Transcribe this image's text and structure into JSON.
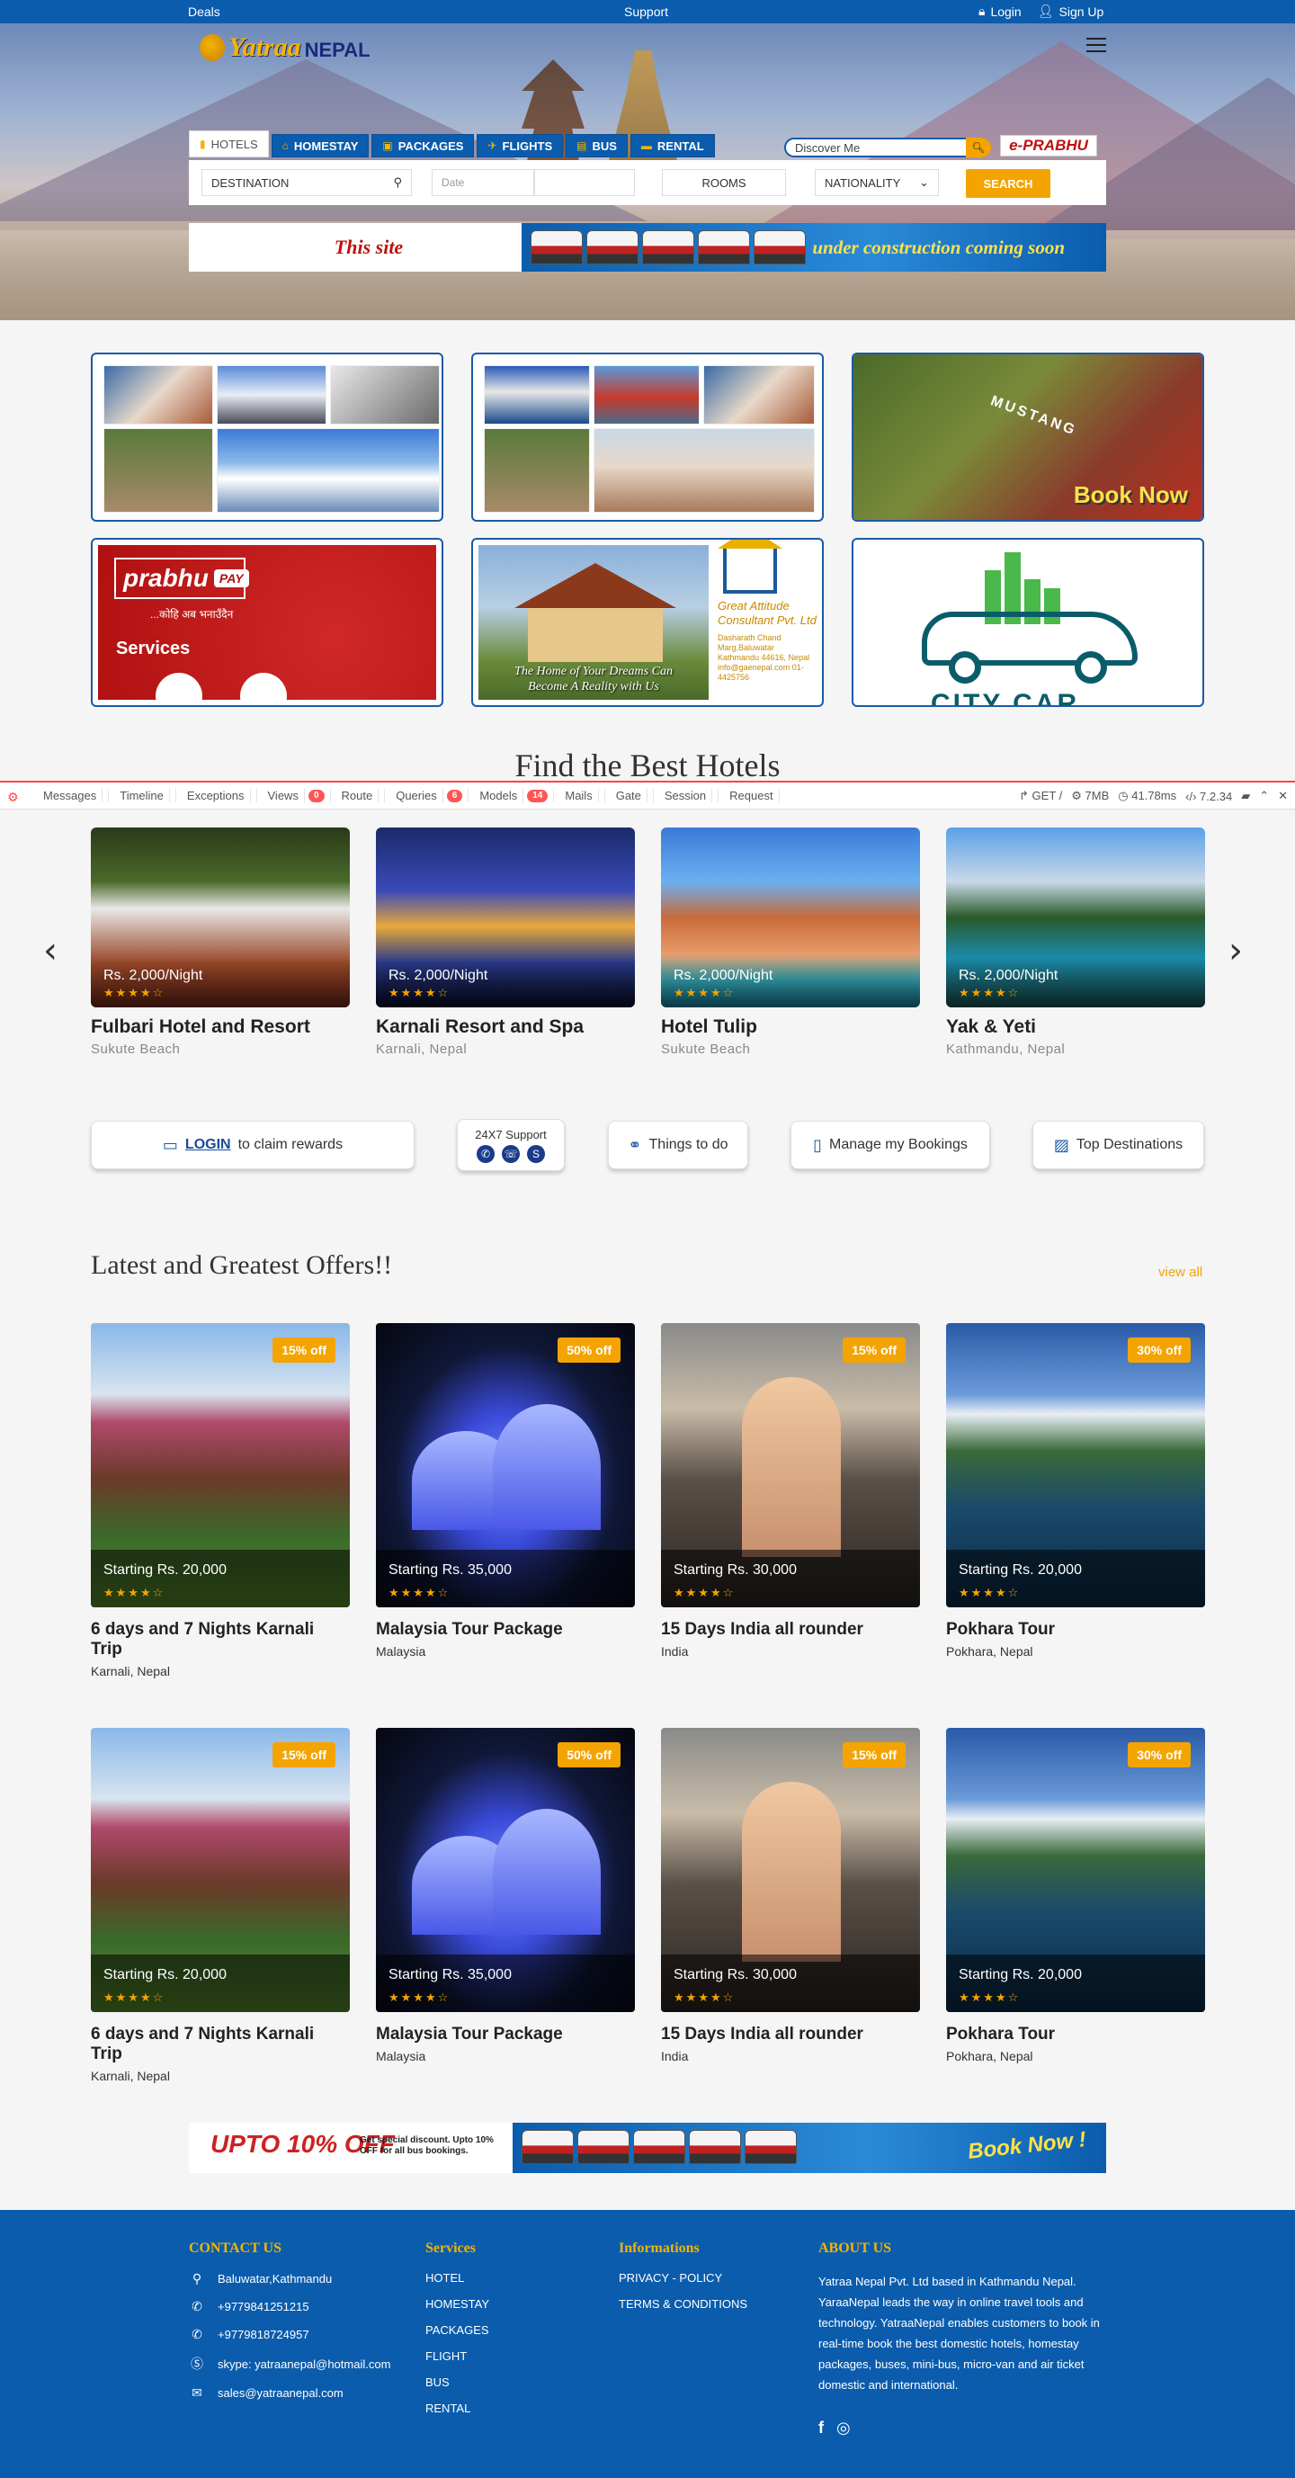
{
  "topbar": {
    "deals": "Deals",
    "support": "Support",
    "login": "Login",
    "signup": "Sign Up"
  },
  "logo": {
    "word": "Yatraa",
    "sub": "NEPAL"
  },
  "search": {
    "tabs": [
      {
        "label": "HOTELS",
        "icon": "building-icon"
      },
      {
        "label": "HOMESTAY",
        "icon": "home-icon"
      },
      {
        "label": "PACKAGES",
        "icon": "suitcase-icon"
      },
      {
        "label": "FLIGHTS",
        "icon": "plane-icon"
      },
      {
        "label": "BUS",
        "icon": "bus-icon"
      },
      {
        "label": "RENTAL",
        "icon": "car-icon"
      }
    ],
    "discover_placeholder": "Discover Me",
    "eprabhu": "e-PRABHU",
    "destination": "DESTINATION",
    "date_placeholder": "Date",
    "rooms": "ROOMS",
    "nationality": "NATIONALITY",
    "button": "SEARCH"
  },
  "construction_banner": {
    "left": "This site",
    "right": "under construction coming soon"
  },
  "promos": {
    "mustang_book": "Book Now",
    "mustang_sign": "MUSTANG",
    "prabhu_logo": "prabhu",
    "prabhu_pay": "PAY",
    "prabhu_tagline": "...कोहि अब भनाउँदैन",
    "prabhu_services": "Services",
    "house_tagline_1": "The Home of Your Dreams Can",
    "house_tagline_2": "Become A Reality with Us",
    "gac_name": "Great Attitude Consultant Pvt. Ltd",
    "gac_address": "Dasharath Chand Marg,Baluwatar Kathmandu 44616, Nepal info@gaenepal.com 01-4425756",
    "citycar": "CITY CAR"
  },
  "hotels_section": {
    "title": "Find the Best Hotels"
  },
  "debugbar": {
    "items": [
      {
        "label": "Messages"
      },
      {
        "label": "Timeline"
      },
      {
        "label": "Exceptions"
      },
      {
        "label": "Views",
        "badge": "0"
      },
      {
        "label": "Route"
      },
      {
        "label": "Queries",
        "badge": "6"
      },
      {
        "label": "Models",
        "badge": "14"
      },
      {
        "label": "Mails"
      },
      {
        "label": "Gate"
      },
      {
        "label": "Session"
      },
      {
        "label": "Request"
      }
    ],
    "method": "GET /",
    "memory": "7MB",
    "time": "41.78ms",
    "version": "7.2.34"
  },
  "hotels": [
    {
      "name": "Fulbari Hotel and Resort",
      "location": "Sukute Beach",
      "price": "Rs. 2,000/Night",
      "rating": 4
    },
    {
      "name": "Karnali Resort and Spa",
      "location": "Karnali, Nepal",
      "price": "Rs. 2,000/Night",
      "rating": 4
    },
    {
      "name": "Hotel Tulip",
      "location": "Sukute Beach",
      "price": "Rs. 2,000/Night",
      "rating": 4
    },
    {
      "name": "Yak & Yeti",
      "location": "Kathmandu, Nepal",
      "price": "Rs. 2,000/Night",
      "rating": 4
    }
  ],
  "quicklinks": {
    "login": "LOGIN",
    "claim": "to claim rewards",
    "support": "24X7 Support",
    "things": "Things to do",
    "bookings": "Manage my Bookings",
    "destinations": "Top Destinations"
  },
  "offers_section": {
    "title": "Latest and Greatest Offers!!",
    "view_all": "view all"
  },
  "offers": [
    {
      "name": "6 days and 7 Nights Karnali Trip",
      "location": "Karnali, Nepal",
      "price": "Starting Rs. 20,000",
      "discount": "15% off",
      "rating": 4
    },
    {
      "name": "Malaysia Tour Package",
      "location": "Malaysia",
      "price": "Starting Rs. 35,000",
      "discount": "50% off",
      "rating": 4
    },
    {
      "name": "15 Days India all rounder",
      "location": "India",
      "price": "Starting Rs. 30,000",
      "discount": "15% off",
      "rating": 4
    },
    {
      "name": "Pokhara Tour",
      "location": "Pokhara, Nepal",
      "price": "Starting Rs. 20,000",
      "discount": "30% off",
      "rating": 4
    },
    {
      "name": "6 days and 7 Nights Karnali Trip",
      "location": "Karnali, Nepal",
      "price": "Starting Rs. 20,000",
      "discount": "15% off",
      "rating": 4
    },
    {
      "name": "Malaysia Tour Package",
      "location": "Malaysia",
      "price": "Starting Rs. 35,000",
      "discount": "50% off",
      "rating": 4
    },
    {
      "name": "15 Days India all rounder",
      "location": "India",
      "price": "Starting Rs. 30,000",
      "discount": "15% off",
      "rating": 4
    },
    {
      "name": "Pokhara Tour",
      "location": "Pokhara, Nepal",
      "price": "Starting Rs. 20,000",
      "discount": "30% off",
      "rating": 4
    }
  ],
  "bus_banner": {
    "upto": "UPTO 10% OFF",
    "discount": "Get special discount. Upto 10% OFF for all bus bookings.",
    "book": "Book Now !"
  },
  "footer": {
    "contact_title": "CONTACT US",
    "contact": {
      "address": "Baluwatar,Kathmandu",
      "phone1": "+9779841251215",
      "phone2": "+9779818724957",
      "skype": "skype: yatraanepal@hotmail.com",
      "email": "sales@yatraanepal.com"
    },
    "services_title": "Services",
    "services": [
      "HOTEL",
      "HOMESTAY",
      "PACKAGES",
      "FLIGHT",
      "BUS",
      "RENTAL"
    ],
    "info_title": "Informations",
    "info": [
      "PRIVACY - POLICY",
      "TERMS & CONDITIONS"
    ],
    "about_title": "ABOUT US",
    "about": "Yatraa Nepal Pvt. Ltd based in Kathmandu Nepal. YaraaNepal leads the way in online travel tools and technology. YatraaNepal enables customers to book in real-time book the best domestic hotels, homestay packages, buses, mini-bus, micro-van and air ticket domestic and international."
  },
  "colors": {
    "brand_blue": "#0b5cad",
    "accent_orange": "#f4a400",
    "heading_gold": "#f4b400"
  }
}
